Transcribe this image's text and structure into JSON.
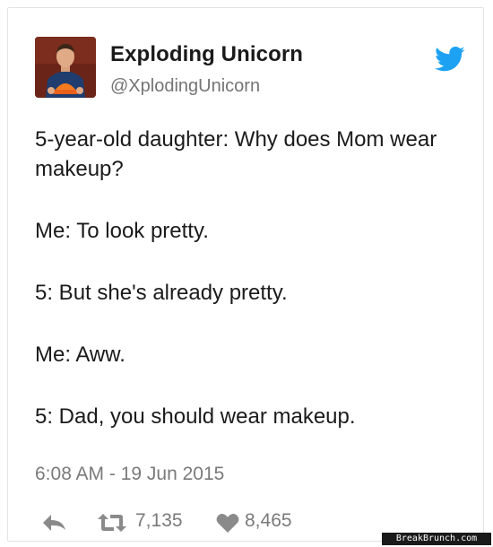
{
  "author": {
    "display_name": "Exploding Unicorn",
    "handle": "@XplodingUnicorn",
    "avatar_icon": "profile-photo"
  },
  "brand": {
    "icon": "twitter-bird-icon",
    "color": "#1da1f2"
  },
  "tweet": {
    "paragraphs": [
      "5-year-old daughter: Why does Mom wear makeup?",
      "Me: To look pretty.",
      "5: But she's already pretty.",
      "Me: Aww.",
      "5: Dad, you should wear makeup."
    ],
    "timestamp": "6:08 AM - 19 Jun 2015"
  },
  "actions": {
    "reply_icon": "reply-arrow-icon",
    "retweet_icon": "retweet-icon",
    "retweet_count": "7,135",
    "like_icon": "heart-icon",
    "like_count": "8,465",
    "icon_color": "#8a8a8a"
  },
  "watermark": {
    "text": "BreakBrunch.com"
  }
}
